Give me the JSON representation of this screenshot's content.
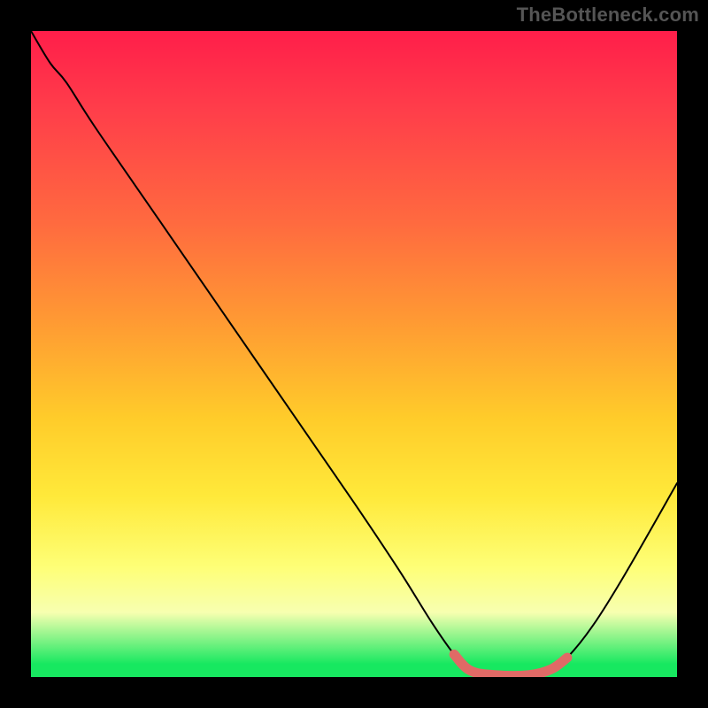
{
  "watermark": "TheBottleneck.com",
  "chart_data": {
    "type": "line",
    "title": "",
    "xlabel": "",
    "ylabel": "",
    "xlim": [
      0,
      100
    ],
    "ylim": [
      0,
      100
    ],
    "series": [
      {
        "name": "black-curve",
        "color": "#000000",
        "points": [
          {
            "x": 0.0,
            "y": 100.0
          },
          {
            "x": 3.0,
            "y": 95.0
          },
          {
            "x": 5.5,
            "y": 92.0
          },
          {
            "x": 10.0,
            "y": 85.0
          },
          {
            "x": 20.0,
            "y": 70.5
          },
          {
            "x": 30.0,
            "y": 56.0
          },
          {
            "x": 40.0,
            "y": 41.5
          },
          {
            "x": 50.0,
            "y": 27.0
          },
          {
            "x": 57.0,
            "y": 16.5
          },
          {
            "x": 62.0,
            "y": 8.5
          },
          {
            "x": 65.5,
            "y": 3.5
          },
          {
            "x": 68.0,
            "y": 1.0
          },
          {
            "x": 72.0,
            "y": 0.3
          },
          {
            "x": 77.0,
            "y": 0.3
          },
          {
            "x": 80.5,
            "y": 1.2
          },
          {
            "x": 83.0,
            "y": 3.0
          },
          {
            "x": 87.0,
            "y": 8.0
          },
          {
            "x": 92.0,
            "y": 16.0
          },
          {
            "x": 100.0,
            "y": 30.0
          }
        ]
      },
      {
        "name": "red-highlight",
        "color": "#e06a66",
        "points": [
          {
            "x": 65.5,
            "y": 3.5
          },
          {
            "x": 68.0,
            "y": 1.0
          },
          {
            "x": 72.0,
            "y": 0.3
          },
          {
            "x": 77.0,
            "y": 0.3
          },
          {
            "x": 80.5,
            "y": 1.2
          },
          {
            "x": 83.0,
            "y": 3.0
          }
        ]
      }
    ],
    "gradient_stops": [
      {
        "pos": 0.0,
        "color": "#ff1e4a"
      },
      {
        "pos": 0.3,
        "color": "#ff6b3f"
      },
      {
        "pos": 0.6,
        "color": "#ffcc2a"
      },
      {
        "pos": 0.83,
        "color": "#feff77"
      },
      {
        "pos": 0.98,
        "color": "#17e860"
      }
    ]
  }
}
